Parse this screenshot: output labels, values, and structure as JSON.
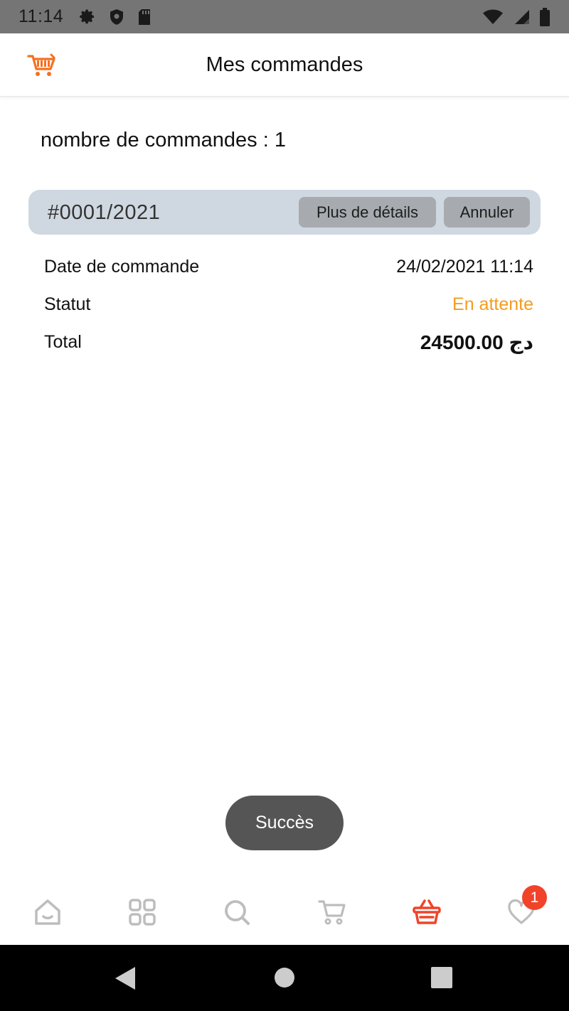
{
  "status_bar": {
    "time": "11:14",
    "left_icons": [
      "gear-icon",
      "shield-icon",
      "sd-card-icon"
    ],
    "right_icons": [
      "wifi-icon",
      "signal-icon",
      "battery-icon"
    ],
    "background": "#757575"
  },
  "app_bar": {
    "title": "Mes commandes",
    "logo_icon": "shopping-cart-logo-icon",
    "logo_color": "#f37021"
  },
  "orders": {
    "count_text": "nombre de commandes : 1",
    "items": [
      {
        "number": "#0001/2021",
        "details_button": "Plus de détails",
        "cancel_button": "Annuler",
        "date_label": "Date de commande",
        "date_value": "24/02/2021 11:14",
        "status_label": "Statut",
        "status_value": "En attente",
        "status_color": "#f39c1f",
        "total_label": "Total",
        "total_value": "24500.00 دج"
      }
    ]
  },
  "toast": {
    "text": "Succès"
  },
  "bottom_nav": {
    "items": [
      {
        "icon": "home-icon",
        "active": false
      },
      {
        "icon": "categories-grid-icon",
        "active": false
      },
      {
        "icon": "search-icon",
        "active": false
      },
      {
        "icon": "cart-icon",
        "active": false
      },
      {
        "icon": "orders-basket-icon",
        "active": true
      },
      {
        "icon": "wishlist-heart-icon",
        "active": false,
        "badge": "1"
      }
    ],
    "active_color": "#f0432a",
    "inactive_color": "#bdbdbd"
  },
  "system_nav": {
    "icons": [
      "back-icon",
      "home-circle-icon",
      "recents-icon"
    ]
  }
}
